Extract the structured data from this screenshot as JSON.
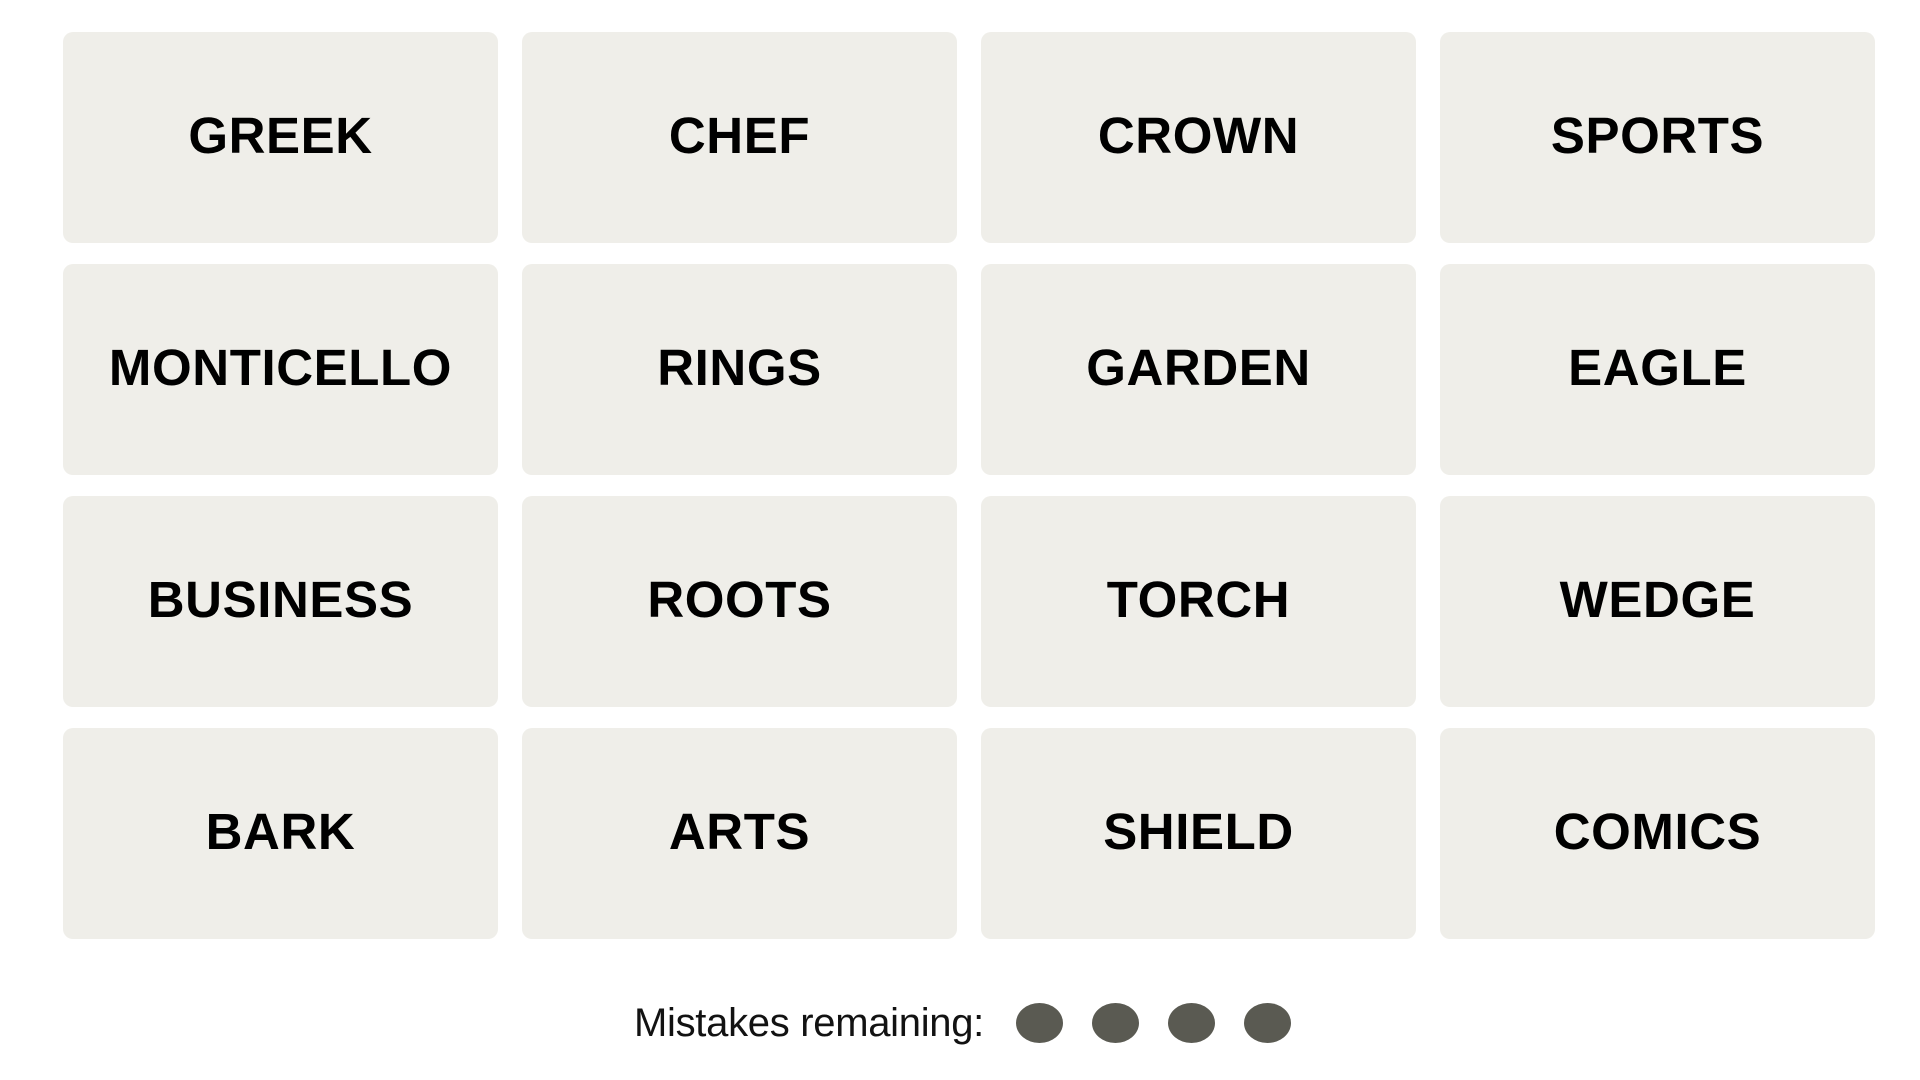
{
  "game": "Connections",
  "board": {
    "tiles": [
      {
        "label": "GREEK"
      },
      {
        "label": "CHEF"
      },
      {
        "label": "CROWN"
      },
      {
        "label": "SPORTS"
      },
      {
        "label": "MONTICELLO"
      },
      {
        "label": "RINGS"
      },
      {
        "label": "GARDEN"
      },
      {
        "label": "EAGLE"
      },
      {
        "label": "BUSINESS"
      },
      {
        "label": "ROOTS"
      },
      {
        "label": "TORCH"
      },
      {
        "label": "WEDGE"
      },
      {
        "label": "BARK"
      },
      {
        "label": "ARTS"
      },
      {
        "label": "SHIELD"
      },
      {
        "label": "COMICS"
      }
    ]
  },
  "status": {
    "mistakes_label": "Mistakes remaining:",
    "mistakes_remaining": 4,
    "dot_color": "#5a5a52"
  },
  "colors": {
    "tile_background": "#efeee9",
    "tile_text": "#000000",
    "page_background": "#ffffff"
  }
}
